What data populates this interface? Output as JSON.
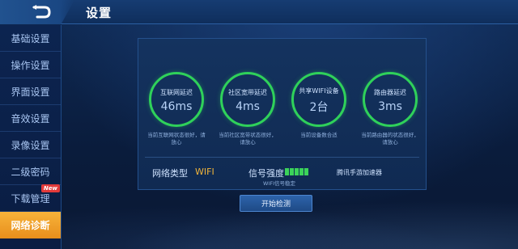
{
  "header": {
    "title": "设置",
    "back_icon": "back-arrow-icon"
  },
  "sidebar": {
    "items": [
      {
        "label": "基础设置"
      },
      {
        "label": "操作设置"
      },
      {
        "label": "界面设置"
      },
      {
        "label": "音效设置"
      },
      {
        "label": "录像设置"
      },
      {
        "label": "二级密码"
      },
      {
        "label": "下载管理",
        "badge": "New"
      },
      {
        "label": "网络诊断",
        "active": true
      }
    ]
  },
  "metrics": [
    {
      "label": "互联网延迟",
      "value": "46ms",
      "desc_line1": "当前互联网状态很好，请",
      "desc_line2": "放心"
    },
    {
      "label": "社区宽带延迟",
      "value": "4ms",
      "desc_line1": "当前社区宽带状态很好，",
      "desc_line2": "请放心"
    },
    {
      "label": "共享WIFI设备",
      "value": "2台",
      "desc_line1": "当前设备数合适",
      "desc_line2": ""
    },
    {
      "label": "路由器延迟",
      "value": "3ms",
      "desc_line1": "当前路由器的状态很好，",
      "desc_line2": "请放心"
    }
  ],
  "network": {
    "type_label": "网络类型",
    "type_value": "WIFI",
    "signal_label": "信号强度",
    "signal_bars": 5,
    "signal_sub": "WIFI信号稳定",
    "accelerator": "腾讯手游加速器"
  },
  "actions": {
    "start_check": "开始检测"
  },
  "colors": {
    "accent": "#f1b53a",
    "ring": "#2fd15a",
    "active_tab": "#f0a02a"
  }
}
